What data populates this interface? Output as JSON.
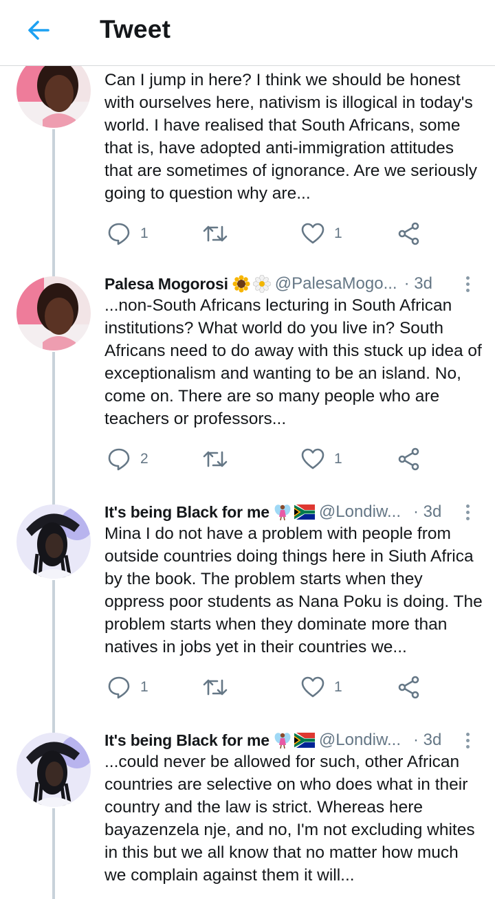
{
  "header": {
    "title": "Tweet",
    "back_icon": "arrow-left-icon",
    "accent": "#1da1f2"
  },
  "tweets": [
    {
      "name": "",
      "handle": "",
      "time": "",
      "text": "Can I jump in here? I think we should be honest with ourselves here, nativism is illogical in today's world. I have realised that South Africans, some that is, have adopted anti-immigration attitudes that are sometimes of ignorance. Are we seriously going to question why are...",
      "replies": "1",
      "retweets": "",
      "likes": "1"
    },
    {
      "name": "Palesa Mogorosi",
      "emojis": [
        "sunflower-emoji",
        "blossom-emoji"
      ],
      "handle": "@PalesaMogo...",
      "time": "· 3d",
      "text": "...non-South Africans lecturing in South African institutions? What world do you live in? South Africans need to do away with this stuck up idea of exceptionalism and wanting to be an island. No, come on. There are so many people who are teachers or professors...",
      "replies": "2",
      "retweets": "",
      "likes": "1"
    },
    {
      "name": "It's being Black for me",
      "emojis": [
        "fairy-emoji",
        "south-africa-flag-emoji"
      ],
      "handle": "@Londiw...",
      "time": "· 3d",
      "text": "Mina I do not have a problem with people from outside countries doing things here in Siuth Africa by the book. The problem starts when they oppress poor students as Nana Poku is doing. The problem starts when they dominate more than natives in jobs yet in their countries we...",
      "replies": "1",
      "retweets": "",
      "likes": "1"
    },
    {
      "name": "It's being Black for me",
      "emojis": [
        "fairy-emoji",
        "south-africa-flag-emoji"
      ],
      "handle": "@Londiw...",
      "time": "· 3d",
      "text": "...could never be allowed for such, other African countries are selective on who does what in their country and the law is strict. Whereas here bayazenzela nje, and no, I'm not excluding whites in this but we all know that no matter how much we complain against them it will..."
    }
  ],
  "colors": {
    "text": "#14171a",
    "secondary": "#657786",
    "thread_line": "#c8d2da",
    "icon": "#657786"
  }
}
